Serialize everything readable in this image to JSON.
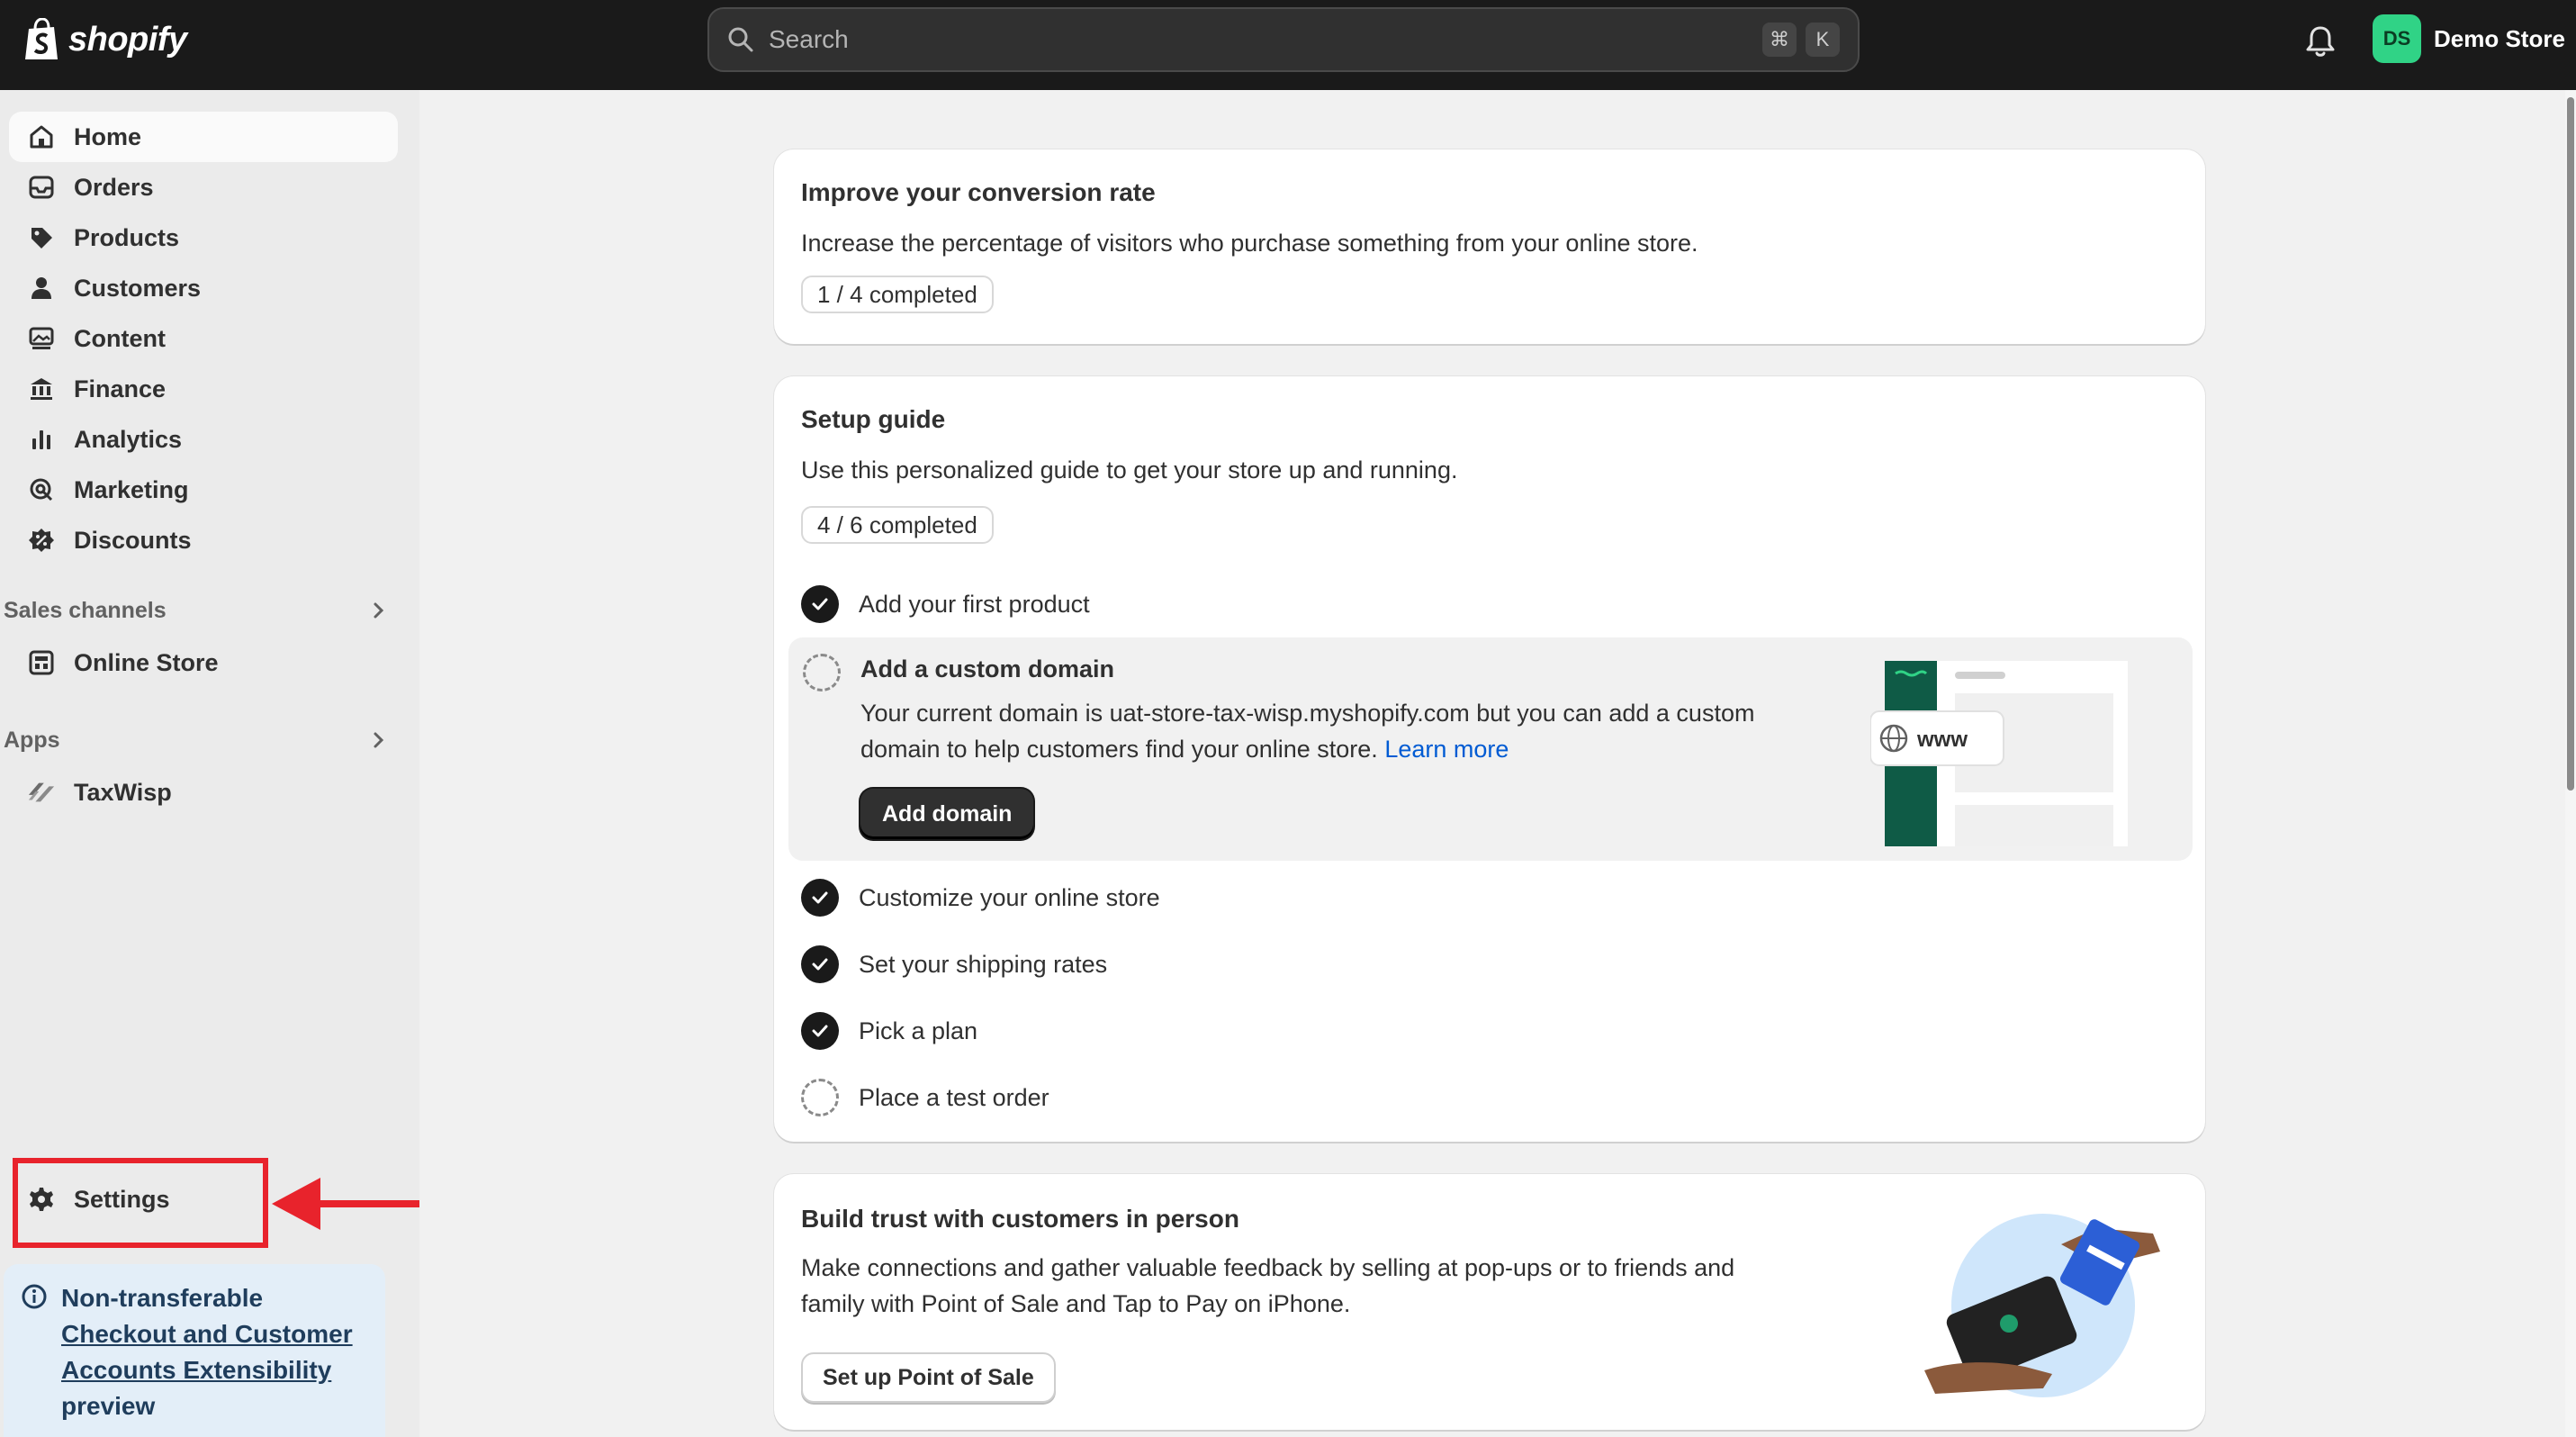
{
  "topbar": {
    "brand": "shopify",
    "search": {
      "placeholder": "Search",
      "shortcut_keys": [
        "⌘",
        "K"
      ]
    },
    "store": {
      "initials": "DS",
      "name": "Demo Store",
      "avatar_color": "#30d386"
    }
  },
  "sidebar": {
    "items": [
      {
        "label": "Home",
        "icon": "home-icon",
        "active": true
      },
      {
        "label": "Orders",
        "icon": "inbox-icon"
      },
      {
        "label": "Products",
        "icon": "tag-icon"
      },
      {
        "label": "Customers",
        "icon": "person-icon"
      },
      {
        "label": "Content",
        "icon": "image-icon"
      },
      {
        "label": "Finance",
        "icon": "bank-icon"
      },
      {
        "label": "Analytics",
        "icon": "bar-chart-icon"
      },
      {
        "label": "Marketing",
        "icon": "target-icon"
      },
      {
        "label": "Discounts",
        "icon": "discount-icon"
      }
    ],
    "sales_channels": {
      "heading": "Sales channels",
      "items": [
        {
          "label": "Online Store",
          "icon": "store-icon"
        }
      ]
    },
    "apps": {
      "heading": "Apps",
      "items": [
        {
          "label": "TaxWisp",
          "icon": "app-icon"
        }
      ]
    },
    "settings": {
      "label": "Settings",
      "icon": "gear-icon"
    },
    "notice": {
      "prefix": "Non-transferable",
      "link": "Checkout and Customer Accounts Extensibility",
      "suffix": "preview"
    }
  },
  "main": {
    "conversion": {
      "title": "Improve your conversion rate",
      "description": "Increase the percentage of visitors who purchase something from your online store.",
      "progress": "1 / 4 completed"
    },
    "setup_guide": {
      "title": "Setup guide",
      "description": "Use this personalized guide to get your store up and running.",
      "progress": "4 / 6 completed",
      "steps": [
        {
          "label": "Add your first product",
          "done": true
        },
        {
          "label": "Add a custom domain",
          "done": false,
          "expanded": true
        },
        {
          "label": "Customize your online store",
          "done": true
        },
        {
          "label": "Set your shipping rates",
          "done": true
        },
        {
          "label": "Pick a plan",
          "done": true
        },
        {
          "label": "Place a test order",
          "done": false
        }
      ],
      "domain_step": {
        "description": "Your current domain is uat-store-tax-wisp.myshopify.com but you can add a custom domain to help customers find your online store.",
        "learn_more": "Learn more",
        "button": "Add domain",
        "illustration_text": "www"
      }
    },
    "pos": {
      "title": "Build trust with customers in person",
      "description": "Make connections and gather valuable feedback by selling at pop-ups or to friends and family with Point of Sale and Tap to Pay on iPhone.",
      "button": "Set up Point of Sale"
    }
  },
  "colors": {
    "highlight": "#e8232c",
    "link": "#005bd3",
    "topbar": "#1a1a1a"
  }
}
